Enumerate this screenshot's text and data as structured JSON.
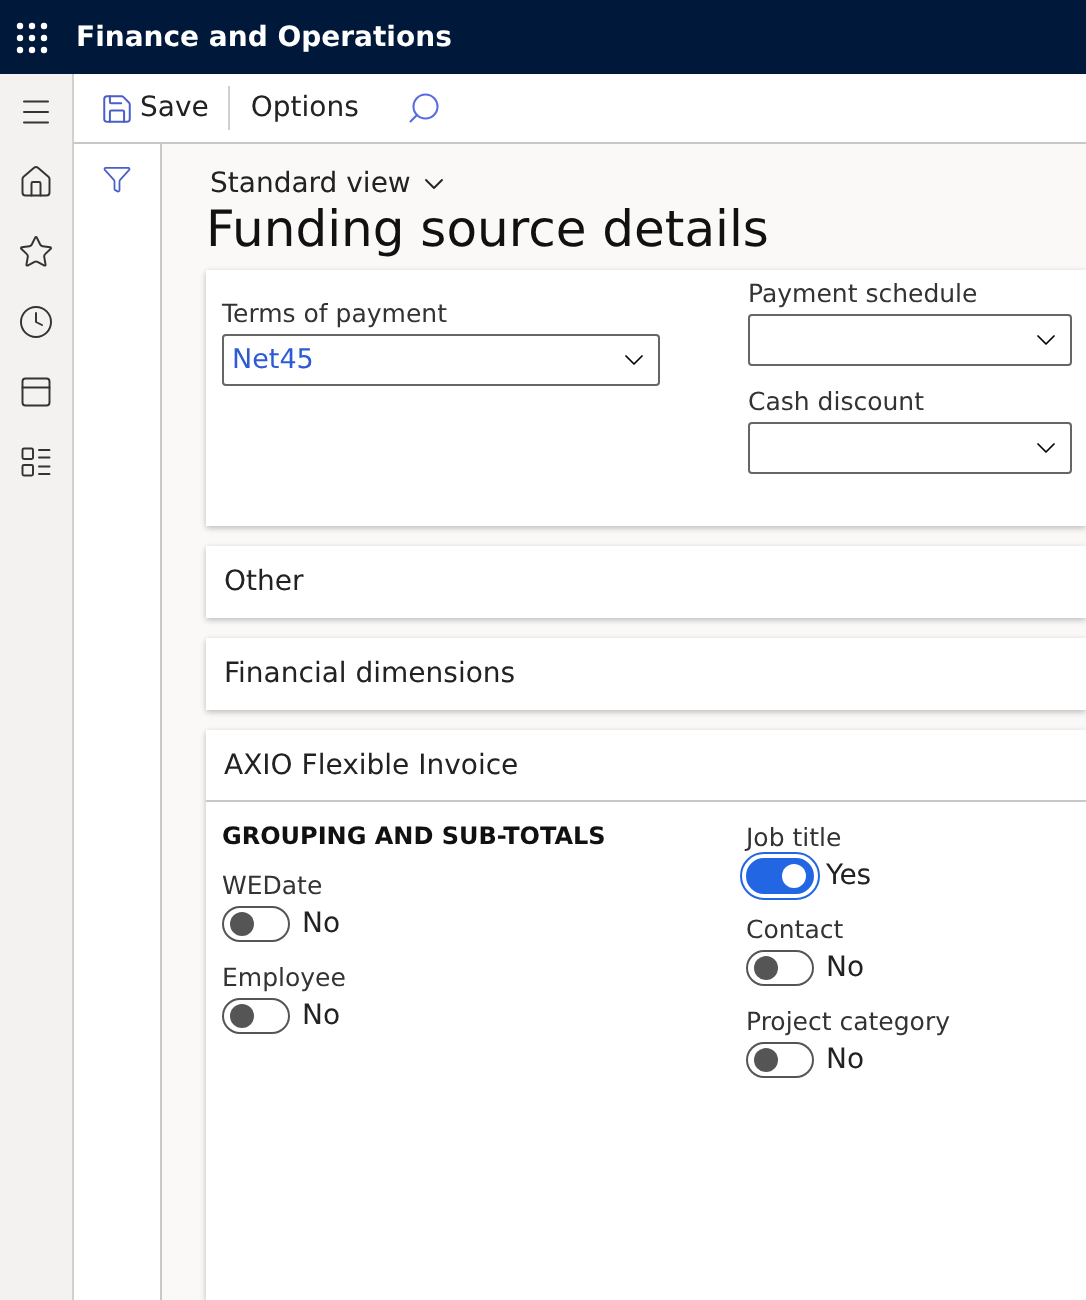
{
  "app_bar": {
    "title": "Finance and Operations"
  },
  "toolbar": {
    "buttons": [
      "Save",
      "Options"
    ]
  },
  "page": {
    "view": "Standard view",
    "title": "Funding source details"
  },
  "payment_panel": {
    "left_fields": [
      {
        "label": "Terms of payment",
        "value": "Net45"
      }
    ],
    "right_fields": [
      {
        "label": "Payment schedule"
      },
      {
        "label": "Cash discount"
      }
    ]
  },
  "sections": [
    {
      "title": "Other"
    },
    {
      "title": "Financial dimensions"
    }
  ],
  "invoice_panel": {
    "title": "AXIO Flexible Invoice",
    "group_heading": "GROUPING AND SUB-TOTALS",
    "left_toggles": [
      {
        "label": "WEDate",
        "on": false,
        "focused": false,
        "text": "No"
      },
      {
        "label": "Employee",
        "on": false,
        "focused": false,
        "text": "No"
      }
    ],
    "right_toggles": [
      {
        "label": "Job title",
        "on": true,
        "focused": true,
        "text": "Yes"
      },
      {
        "label": "Contact",
        "on": false,
        "focused": false,
        "text": "No"
      },
      {
        "label": "Project category",
        "on": false,
        "focused": false,
        "text": "No"
      }
    ]
  }
}
